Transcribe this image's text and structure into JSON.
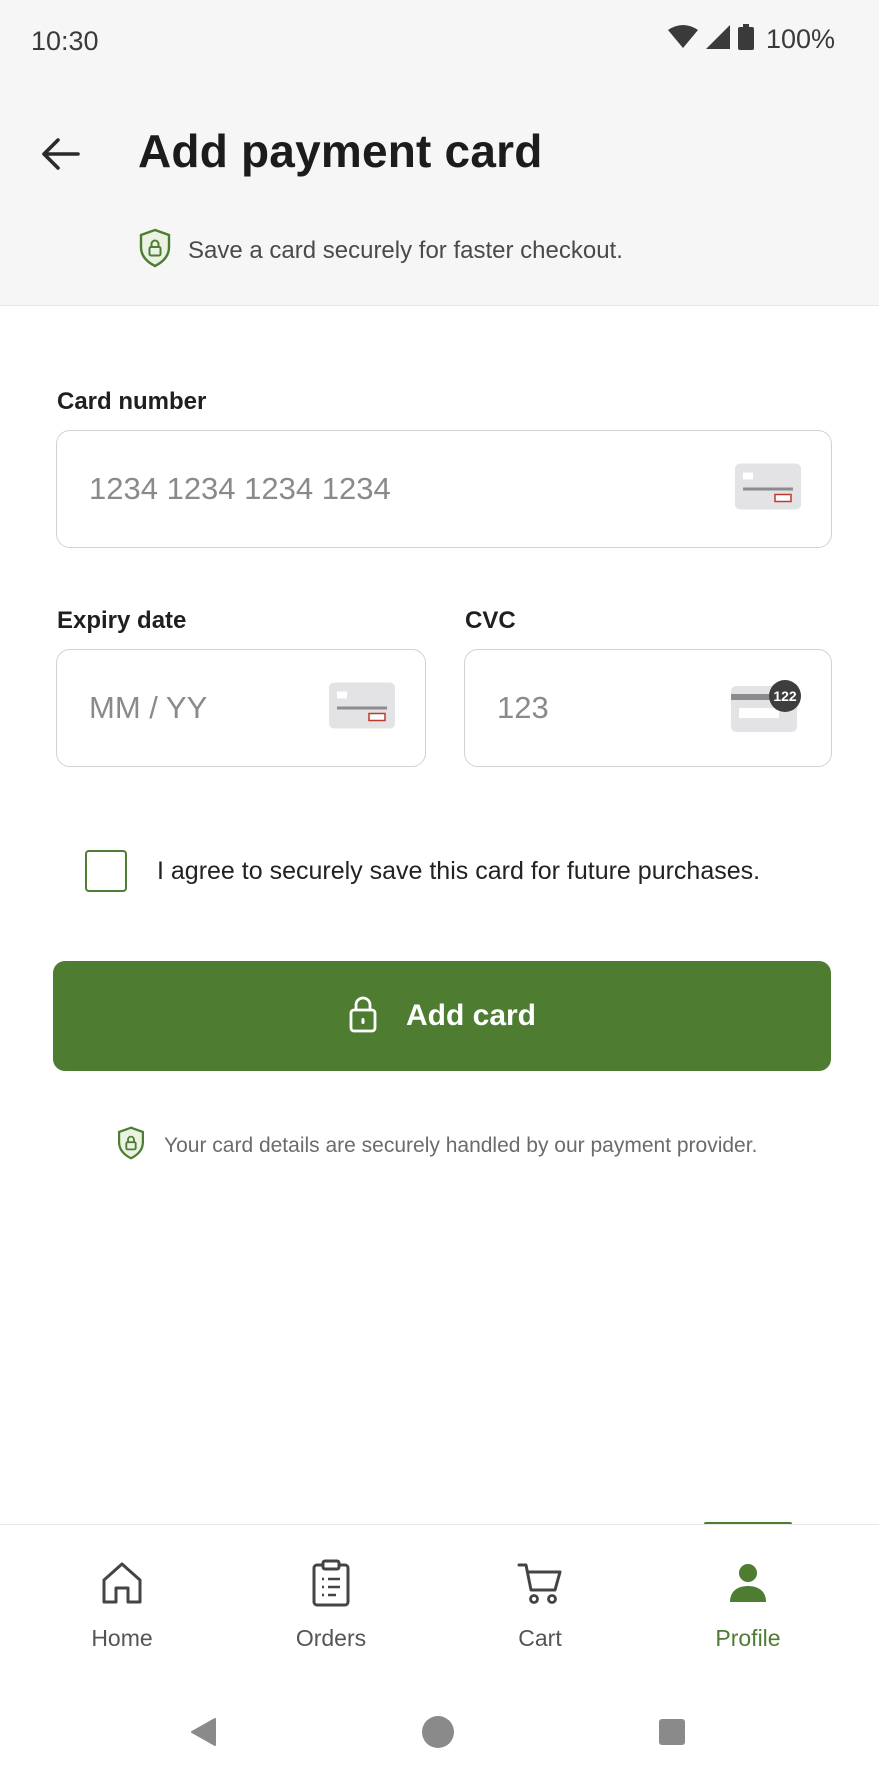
{
  "status_bar": {
    "time": "10:30",
    "battery": "100%"
  },
  "header": {
    "title": "Add payment card",
    "subtitle": "Save a card securely for faster checkout."
  },
  "form": {
    "card_number": {
      "label": "Card number",
      "placeholder": "1234 1234 1234 1234"
    },
    "expiry": {
      "label": "Expiry date",
      "placeholder": "MM / YY"
    },
    "cvc": {
      "label": "CVC",
      "placeholder": "123",
      "badge": "122"
    },
    "agree_text": "I agree to securely save this card for future purchases.",
    "submit_label": "Add card",
    "secure_note": "Your card details are securely handled by our payment provider."
  },
  "bottom_nav": {
    "items": [
      {
        "label": "Home",
        "icon": "home-icon"
      },
      {
        "label": "Orders",
        "icon": "clipboard-icon"
      },
      {
        "label": "Cart",
        "icon": "cart-icon"
      },
      {
        "label": "Profile",
        "icon": "person-icon",
        "active": true
      }
    ]
  },
  "colors": {
    "accent": "#4e7d32",
    "header_bg": "#f6f6f6"
  }
}
